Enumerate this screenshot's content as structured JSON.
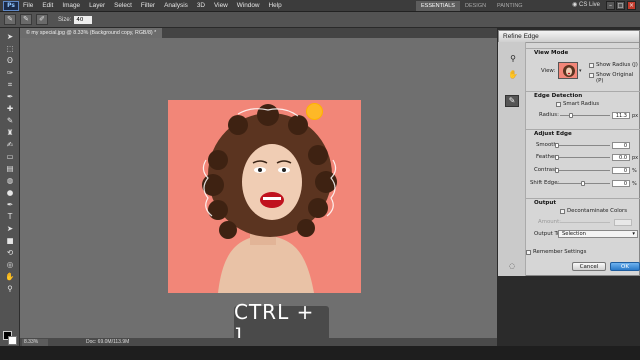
{
  "app": {
    "logo": "Ps"
  },
  "menu": [
    "File",
    "Edit",
    "Image",
    "Layer",
    "Select",
    "Filter",
    "Analysis",
    "3D",
    "View",
    "Window",
    "Help"
  ],
  "workspaces": [
    "ESSENTIALS",
    "DESIGN",
    "PAINTING"
  ],
  "cs_live": "CS Live",
  "options_bar": {
    "size_label": "Size:",
    "size_value": "40"
  },
  "document": {
    "tab_title": "© my special.jpg @ 8.33% (Background copy, RGB/8) *"
  },
  "status": {
    "zoom": "8.33%",
    "doc_info": "Doc: 69.0M/113.9M"
  },
  "overlay": {
    "shortcut": "CTRL + ]"
  },
  "dialog": {
    "title": "Refine Edge",
    "view_mode": {
      "heading": "View Mode",
      "view_label": "View:",
      "show_radius": "Show Radius (J)",
      "show_original": "Show Original (P)"
    },
    "edge_detection": {
      "heading": "Edge Detection",
      "smart_radius": "Smart Radius",
      "radius_label": "Radius:",
      "radius_value": "11.3",
      "radius_unit": "px",
      "radius_level": 0.22
    },
    "adjust_edge": {
      "heading": "Adjust Edge",
      "smooth_label": "Smooth:",
      "smooth_value": "0",
      "feather_label": "Feather:",
      "feather_value": "0.0",
      "feather_unit": "px",
      "contrast_label": "Contrast:",
      "contrast_value": "0",
      "contrast_unit": "%",
      "shift_label": "Shift Edge:",
      "shift_value": "0",
      "shift_unit": "%",
      "shift_level": 0.5
    },
    "output": {
      "heading": "Output",
      "decontaminate": "Decontaminate Colors",
      "amount_label": "Amount:",
      "output_to_label": "Output To:",
      "output_to_value": "Selection"
    },
    "remember": "Remember Settings",
    "cancel": "Cancel",
    "ok": "OK"
  },
  "colors": {
    "photo_background": "#f28678",
    "dialog_bg": "#d6d6d6",
    "ok_button": "#2a79c8"
  }
}
